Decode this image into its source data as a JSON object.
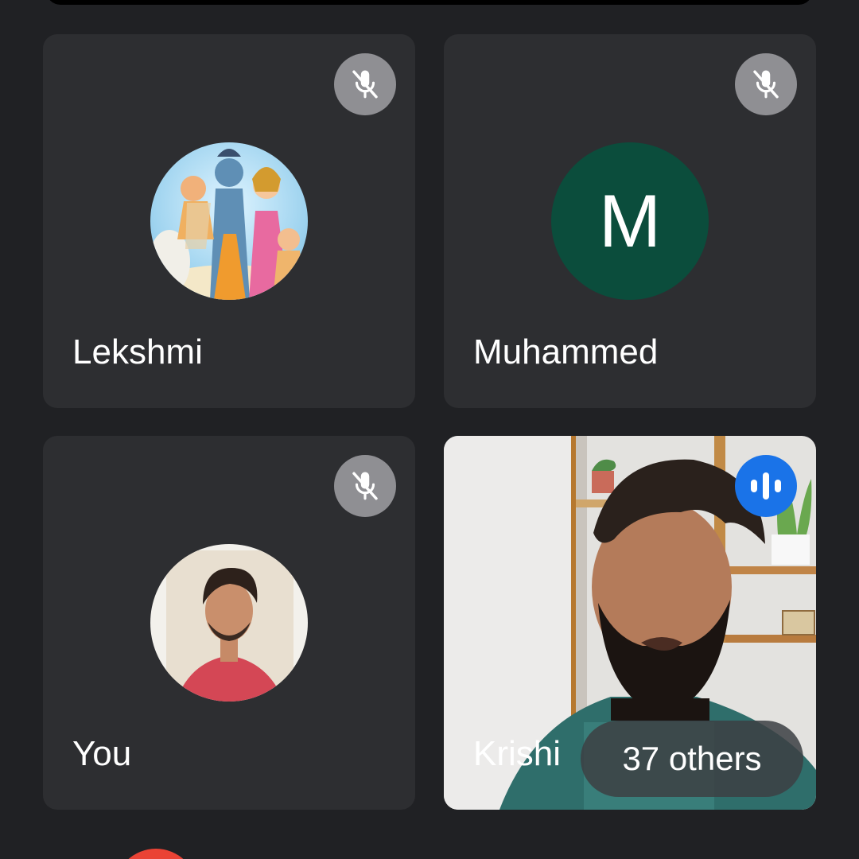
{
  "participants": [
    {
      "name": "Lekshmi",
      "mic": "muted",
      "avatar": "photo",
      "icon": "mic-off-icon"
    },
    {
      "name": "Muhammed",
      "mic": "muted",
      "avatar": "letter",
      "initial": "M",
      "avatar_color": "#0b4d3c",
      "icon": "mic-off-icon"
    },
    {
      "name": "You",
      "mic": "muted",
      "avatar": "photo",
      "icon": "mic-off-icon"
    },
    {
      "name": "Krishi",
      "mic": "speaking",
      "avatar": "video",
      "icon": "audio-level-icon"
    }
  ],
  "others_chip": {
    "label": "37 others"
  },
  "colors": {
    "background": "#202124",
    "tile": "#2d2e31",
    "mute_badge": "#8f8f93",
    "speaking_badge": "#1a73e8",
    "end_call": "#ea4335"
  }
}
